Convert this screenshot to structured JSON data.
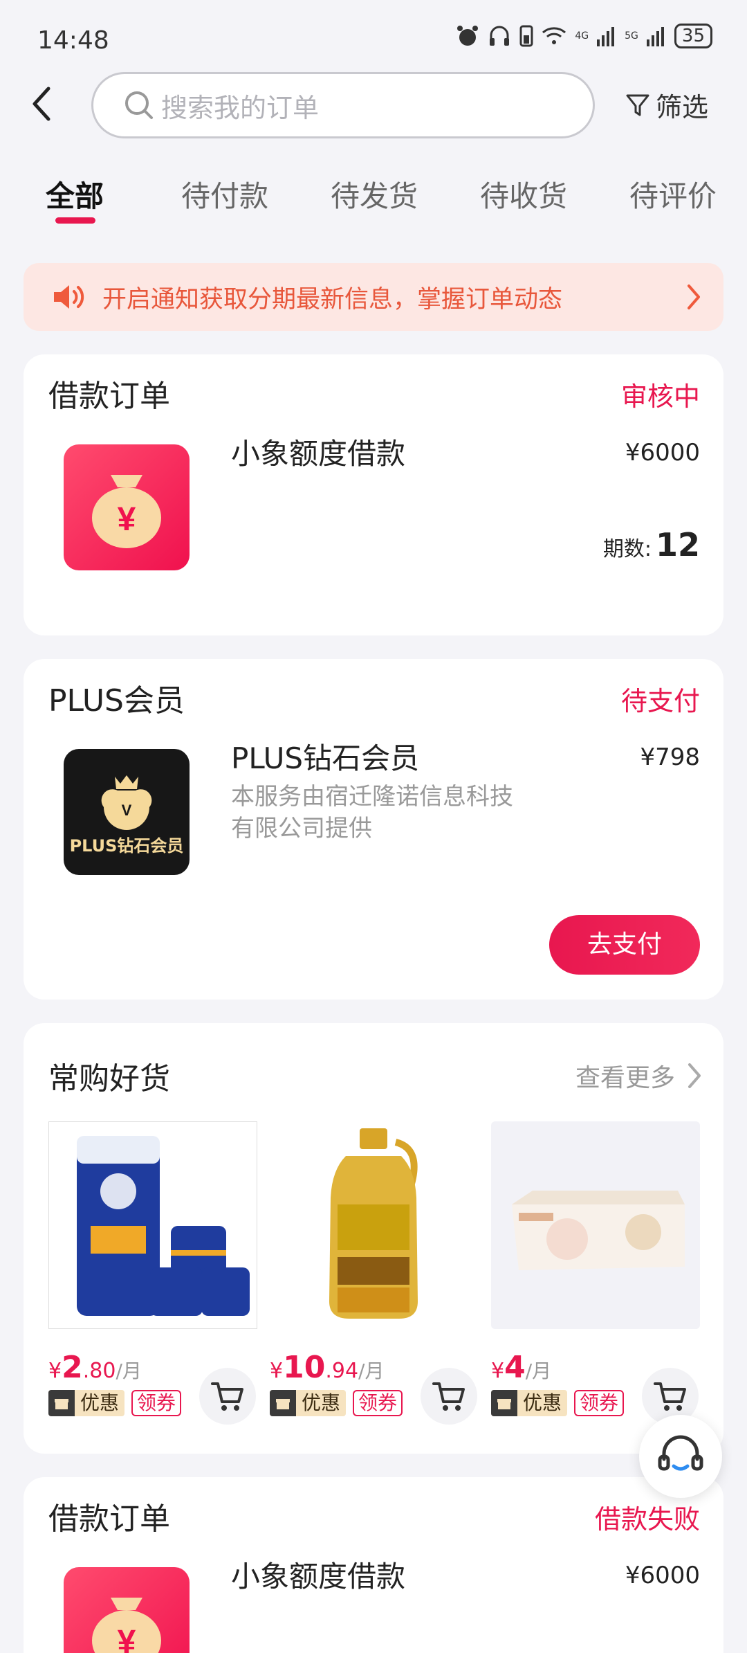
{
  "status_bar": {
    "time": "14:48",
    "battery": "35",
    "net1": "4G",
    "net2": "5G"
  },
  "header": {
    "search_placeholder": "搜索我的订单",
    "filter_label": "筛选"
  },
  "tabs": [
    {
      "label": "全部",
      "active": true
    },
    {
      "label": "待付款",
      "active": false
    },
    {
      "label": "待发货",
      "active": false
    },
    {
      "label": "待收货",
      "active": false
    },
    {
      "label": "待评价",
      "active": false
    }
  ],
  "notice": {
    "text": "开启通知获取分期最新信息，掌握订单动态"
  },
  "orders": [
    {
      "title": "借款订单",
      "status": "审核中",
      "product": "小象额度借款",
      "price": "¥6000",
      "terms_label": "期数:",
      "terms_value": "12"
    },
    {
      "title": "PLUS会员",
      "status": "待支付",
      "product": "PLUS钻石会员",
      "price": "¥798",
      "description": "本服务由宿迁隆诺信息科技有限公司提供",
      "icon_label": "PLUS钻石会员",
      "action": "去支付"
    },
    {
      "title": "借款订单",
      "status": "借款失败",
      "product": "小象额度借款",
      "price": "¥6000"
    }
  ],
  "goods_section": {
    "title": "常购好货",
    "more_label": "查看更多",
    "items": [
      {
        "currency": "¥",
        "price_int": "2",
        "price_dec": ".80",
        "unit": "/月",
        "tag_discount": "优惠",
        "tag_coupon": "领券"
      },
      {
        "currency": "¥",
        "price_int": "10",
        "price_dec": ".94",
        "unit": "/月",
        "tag_discount": "优惠",
        "tag_coupon": "领券"
      },
      {
        "currency": "¥",
        "price_int": "4",
        "price_dec": "",
        "unit": "/月",
        "tag_discount": "优惠",
        "tag_coupon": "领券"
      }
    ]
  },
  "colors": {
    "accent": "#e8174f",
    "notice_bg": "#fde7e3",
    "notice_text": "#e8573b"
  }
}
